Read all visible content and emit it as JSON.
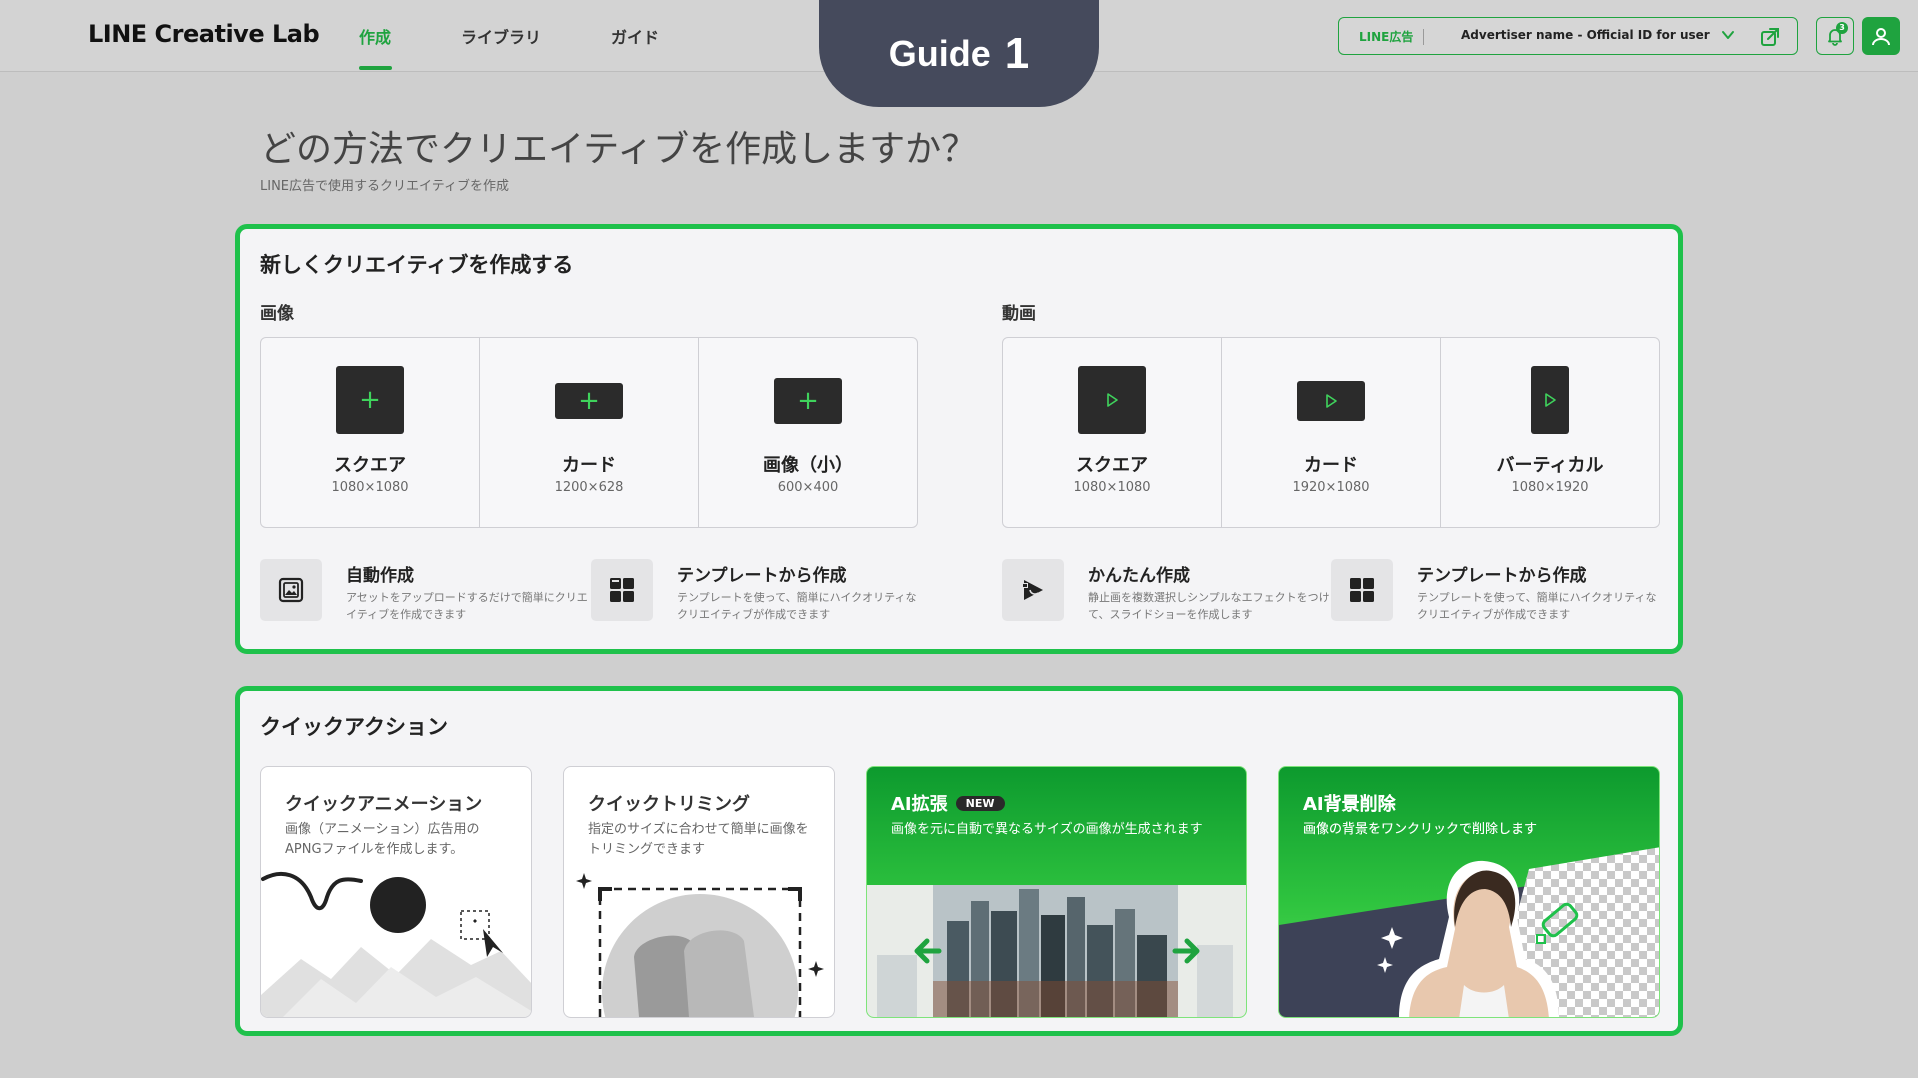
{
  "app": {
    "logo": "LINE Creative Lab",
    "nav": [
      {
        "label": "作成",
        "active": true
      },
      {
        "label": "ライブラリ",
        "active": false
      },
      {
        "label": "ガイド",
        "active": false
      }
    ],
    "guide_badge": {
      "label": "Guide",
      "number": "1"
    },
    "account": {
      "channel_label": "LINE広告",
      "name": "Advertiser name - Official ID for user"
    },
    "notifications_count": "3",
    "accent_color": "#1fa33f",
    "highlight_color": "#1fc14b"
  },
  "page": {
    "title": "どの方法でクリエイティブを作成しますか？",
    "subtitle": "LINE広告で使用するクリエイティブを作成"
  },
  "create_panel": {
    "title": "新しくクリエイティブを作成する",
    "image": {
      "label": "画像",
      "formats": [
        {
          "name": "スクエア",
          "size": "1080×1080",
          "icon": "plus-icon"
        },
        {
          "name": "カード",
          "size": "1200×628",
          "icon": "plus-icon"
        },
        {
          "name": "画像（小）",
          "size": "600×400",
          "icon": "plus-icon"
        }
      ],
      "options": [
        {
          "title": "自動作成",
          "desc": "アセットをアップロードするだけで簡単にクリエイティブを作成できます",
          "icon": "auto-image-icon"
        },
        {
          "title": "テンプレートから作成",
          "desc": "テンプレートを使って、簡単にハイクオリティなクリエイティブが作成できます",
          "icon": "template-grid-icon"
        }
      ]
    },
    "video": {
      "label": "動画",
      "formats": [
        {
          "name": "スクエア",
          "size": "1080×1080",
          "icon": "play-icon"
        },
        {
          "name": "カード",
          "size": "1920×1080",
          "icon": "play-icon"
        },
        {
          "name": "バーティカル",
          "size": "1080×1920",
          "icon": "play-icon"
        }
      ],
      "options": [
        {
          "title": "かんたん作成",
          "desc": "静止画を複数選択しシンプルなエフェクトをつけて、スライドショーを作成します",
          "icon": "easy-video-icon"
        },
        {
          "title": "テンプレートから作成",
          "desc": "テンプレートを使って、簡単にハイクオリティなクリエイティブが作成できます",
          "icon": "template-grid-icon"
        }
      ]
    }
  },
  "quick_panel": {
    "title": "クイックアクション",
    "cards": [
      {
        "title": "クイックアニメーション",
        "desc": "画像（アニメーション）広告用のAPNGファイルを作成します。",
        "icon": "animation-illustration"
      },
      {
        "title": "クイックトリミング",
        "desc": "指定のサイズに合わせて簡単に画像をトリミングできます",
        "icon": "trimming-illustration"
      },
      {
        "title": "AI拡張",
        "badge": "NEW",
        "desc": "画像を元に自動で異なるサイズの画像が生成されます",
        "icon": "ai-expand-illustration"
      },
      {
        "title": "AI背景削除",
        "desc": "画像の背景をワンクリックで削除します",
        "icon": "ai-bg-remove-illustration"
      }
    ]
  }
}
